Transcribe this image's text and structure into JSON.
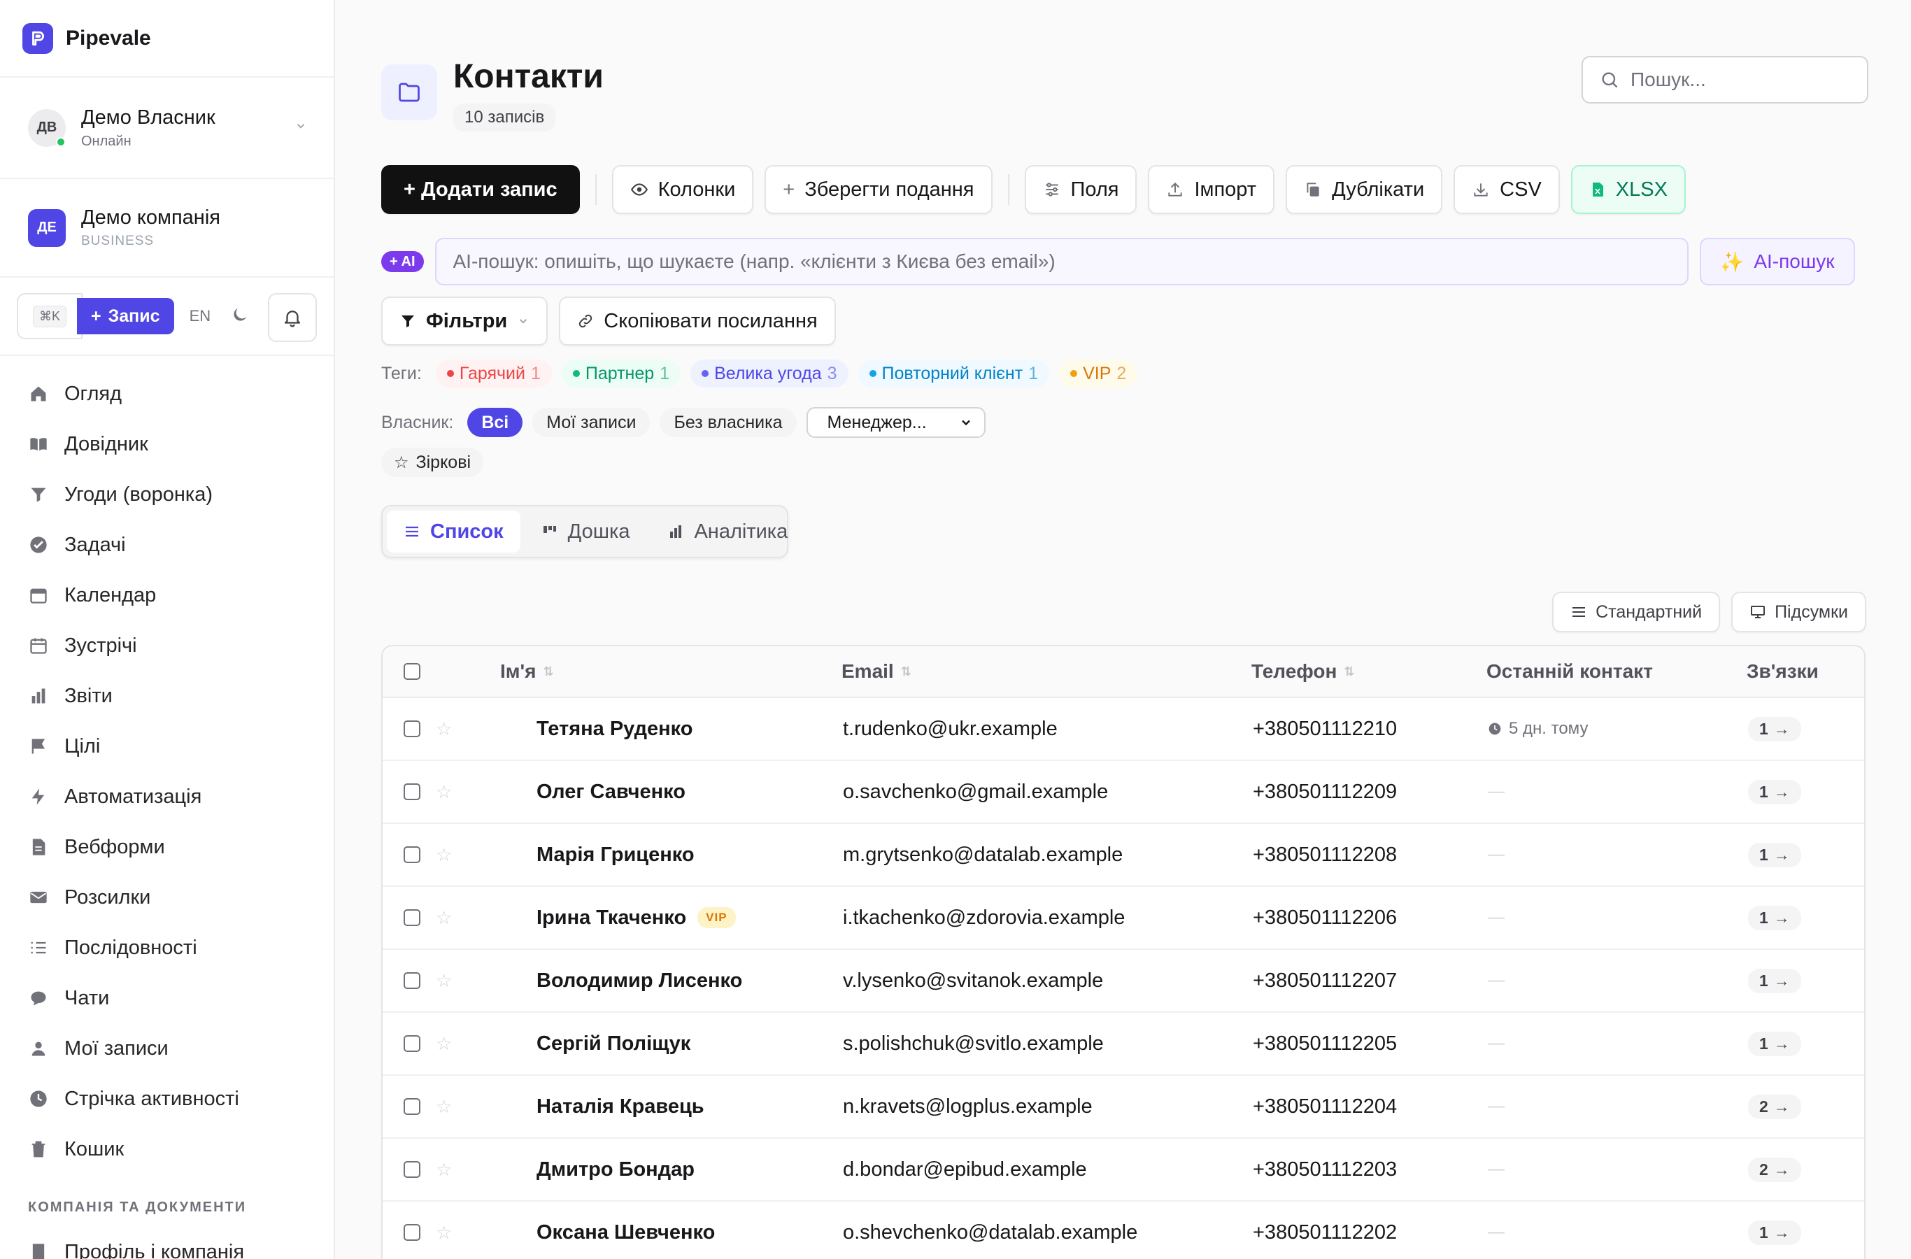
{
  "brand": {
    "name": "Pipevale"
  },
  "user": {
    "initials": "ДВ",
    "name": "Демо Власник",
    "status": "Онлайн"
  },
  "company": {
    "initials": "ДЕ",
    "name": "Демо компанія",
    "plan": "BUSINESS"
  },
  "quick": {
    "shortcut": "⌘K",
    "add_label": "Запис",
    "lang": "EN"
  },
  "nav": [
    {
      "label": "Огляд",
      "icon": "home-icon"
    },
    {
      "label": "Довідник",
      "icon": "book-icon"
    },
    {
      "label": "Угоди (воронка)",
      "icon": "funnel-icon"
    },
    {
      "label": "Задачі",
      "icon": "check-circle-icon"
    },
    {
      "label": "Календар",
      "icon": "calendar-icon"
    },
    {
      "label": "Зустрічі",
      "icon": "calendar-outline-icon"
    },
    {
      "label": "Звіти",
      "icon": "bar-chart-icon"
    },
    {
      "label": "Цілі",
      "icon": "flag-icon"
    },
    {
      "label": "Автоматизація",
      "icon": "bolt-icon"
    },
    {
      "label": "Вебформи",
      "icon": "document-icon"
    },
    {
      "label": "Розсилки",
      "icon": "mail-icon"
    },
    {
      "label": "Послідовності",
      "icon": "list-icon"
    },
    {
      "label": "Чати",
      "icon": "chat-icon"
    },
    {
      "label": "Мої записи",
      "icon": "user-icon"
    },
    {
      "label": "Стрічка активності",
      "icon": "clock-icon"
    },
    {
      "label": "Кошик",
      "icon": "trash-icon"
    }
  ],
  "nav_section": {
    "title": "КОМПАНІЯ ТА ДОКУМЕНТИ",
    "items": [
      {
        "label": "Профіль і компанія"
      }
    ]
  },
  "page": {
    "title": "Контакти",
    "count": "10 записів"
  },
  "search": {
    "placeholder": "Пошук..."
  },
  "toolbar": {
    "add": "+ Додати запис",
    "columns": "Колонки",
    "save_view": "Зберегти подання",
    "fields": "Поля",
    "import": "Імпорт",
    "duplicates": "Дублікати",
    "csv": "CSV",
    "xlsx": "XLSX"
  },
  "ai": {
    "badge": "+ AI",
    "placeholder": "AI-пошук: опишіть, що шукаєте (напр. «клієнти з Києва без email»)",
    "button": "AI-пошук"
  },
  "filters": {
    "filters_label": "Фільтри",
    "copy_link": "Скопіювати посилання"
  },
  "tags": {
    "label": "Теги:",
    "items": [
      {
        "name": "Гарячий",
        "count": "1",
        "color": "#ef4444",
        "bg": "#fef2f2"
      },
      {
        "name": "Партнер",
        "count": "1",
        "color": "#10b981",
        "bg": "#ecfdf5"
      },
      {
        "name": "Велика угода",
        "count": "3",
        "color": "#6366f1",
        "bg": "#eef2ff"
      },
      {
        "name": "Повторний клієнт",
        "count": "1",
        "color": "#0ea5e9",
        "bg": "#f0f9ff"
      },
      {
        "name": "VIP",
        "count": "2",
        "color": "#f59e0b",
        "bg": "#fffbeb"
      }
    ]
  },
  "owner": {
    "label": "Власник:",
    "all": "Всі",
    "mine": "Мої записи",
    "none": "Без власника",
    "select": "Менеджер...",
    "starred": "Зіркові"
  },
  "views": {
    "list": "Список",
    "board": "Дошка",
    "analytics": "Аналітика"
  },
  "mini": {
    "standard": "Стандартний",
    "totals": "Підсумки"
  },
  "table": {
    "headers": {
      "name": "Ім'я",
      "email": "Email",
      "phone": "Телефон",
      "last": "Останній контакт",
      "links": "Зв'язки"
    },
    "rows": [
      {
        "name": "Тетяна Руденко",
        "email": "t.rudenko@ukr.example",
        "phone": "+380501112210",
        "last": "5 дн. тому",
        "links": "1",
        "vip": ""
      },
      {
        "name": "Олег Савченко",
        "email": "o.savchenko@gmail.example",
        "phone": "+380501112209",
        "last": "—",
        "links": "1",
        "vip": ""
      },
      {
        "name": "Марія Гриценко",
        "email": "m.grytsenko@datalab.example",
        "phone": "+380501112208",
        "last": "—",
        "links": "1",
        "vip": ""
      },
      {
        "name": "Ірина Ткаченко",
        "email": "i.tkachenko@zdorovia.example",
        "phone": "+380501112206",
        "last": "—",
        "links": "1",
        "vip": "VIP"
      },
      {
        "name": "Володимир Лисенко",
        "email": "v.lysenko@svitanok.example",
        "phone": "+380501112207",
        "last": "—",
        "links": "1",
        "vip": ""
      },
      {
        "name": "Сергій Поліщук",
        "email": "s.polishchuk@svitlo.example",
        "phone": "+380501112205",
        "last": "—",
        "links": "1",
        "vip": ""
      },
      {
        "name": "Наталія Кравець",
        "email": "n.kravets@logplus.example",
        "phone": "+380501112204",
        "last": "—",
        "links": "2",
        "vip": ""
      },
      {
        "name": "Дмитро Бондар",
        "email": "d.bondar@epibud.example",
        "phone": "+380501112203",
        "last": "—",
        "links": "2",
        "vip": ""
      },
      {
        "name": "Оксана Шевченко",
        "email": "o.shevchenko@datalab.example",
        "phone": "+380501112202",
        "last": "—",
        "links": "1",
        "vip": ""
      }
    ]
  }
}
